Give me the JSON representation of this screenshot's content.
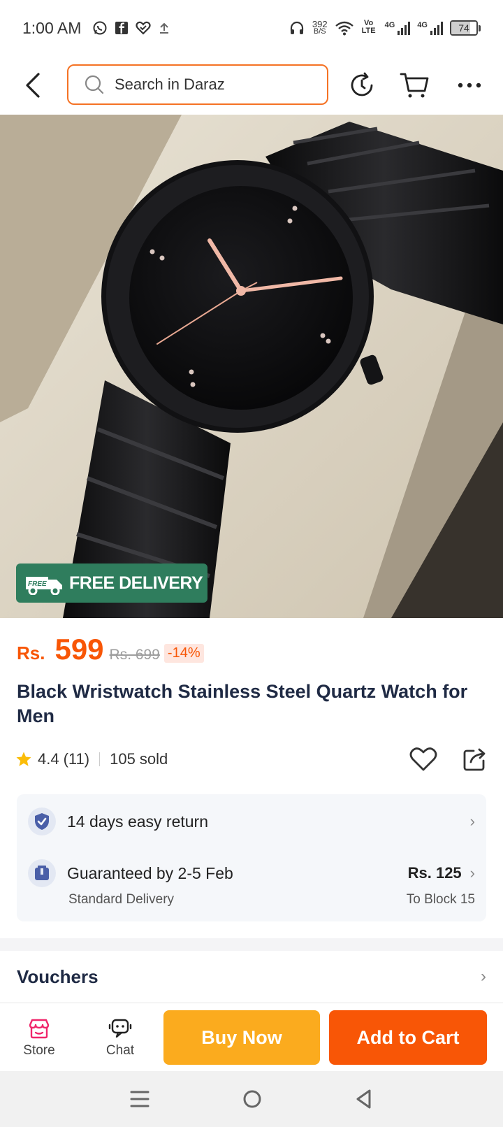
{
  "status_bar": {
    "time": "1:00 AM",
    "net_speed": "392",
    "net_unit": "B/S",
    "volte": "Vo LTE",
    "network_1": "4G",
    "network_2": "4G",
    "battery": "74",
    "battery_level_percent": 74
  },
  "nav": {
    "search_placeholder": "Search in Daraz"
  },
  "badge": {
    "icon_text": "FREE",
    "label": "FREE DELIVERY"
  },
  "price": {
    "currency": "Rs.",
    "current": "599",
    "original": "Rs. 699",
    "discount": "-14%"
  },
  "product": {
    "title": "Black Wristwatch Stainless Steel Quartz Watch for Men",
    "rating": "4.4",
    "rating_count": "(11)",
    "sold": "105 sold"
  },
  "delivery": {
    "return_text": "14 days easy return",
    "guarantee_text": "Guaranteed by 2-5 Feb",
    "delivery_type": "Standard Delivery",
    "fee": "Rs. 125",
    "destination": "To Block 15"
  },
  "vouchers": {
    "title": "Vouchers"
  },
  "actions": {
    "store_label": "Store",
    "chat_label": "Chat",
    "buy_now": "Buy Now",
    "add_to_cart": "Add to Cart"
  },
  "colors": {
    "brand_orange": "#f85606",
    "buy_now_yellow": "#fbab1e",
    "free_delivery_green": "#2f7d5d",
    "title_navy": "#1f2a44"
  }
}
